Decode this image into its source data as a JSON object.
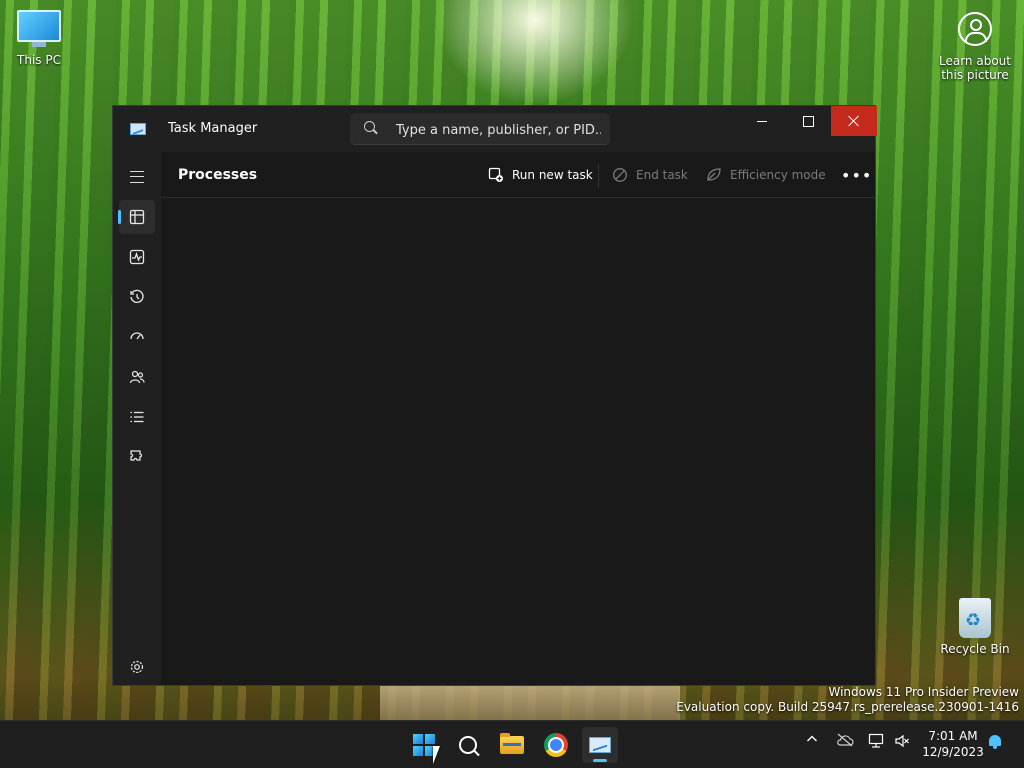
{
  "desktop": {
    "this_pc_label": "This PC",
    "learn_label": "Learn about this picture",
    "recycle_label": "Recycle Bin",
    "watermark_line1": "Windows 11 Pro Insider Preview",
    "watermark_line2": "Evaluation copy. Build 25947.rs_prerelease.230901-1416"
  },
  "window": {
    "title": "Task Manager",
    "search_placeholder": "Type a name, publisher, or PID...",
    "page_title": "Processes",
    "toolbar": {
      "run_new_task": "Run new task",
      "end_task": "End task",
      "efficiency_mode": "Efficiency mode"
    },
    "nav_items": [
      {
        "name": "menu",
        "icon": "hamburger-icon"
      },
      {
        "name": "processes",
        "icon": "processes-icon",
        "active": true
      },
      {
        "name": "performance",
        "icon": "performance-icon"
      },
      {
        "name": "app-history",
        "icon": "history-icon"
      },
      {
        "name": "startup-apps",
        "icon": "startup-icon"
      },
      {
        "name": "users",
        "icon": "users-icon"
      },
      {
        "name": "details",
        "icon": "details-list-icon"
      },
      {
        "name": "services",
        "icon": "services-icon"
      },
      {
        "name": "settings",
        "icon": "gear-icon"
      }
    ]
  },
  "taskbar": {
    "time": "7:01 AM",
    "date": "12/9/2023",
    "items": [
      "start-icon",
      "search-icon",
      "file-explorer-icon",
      "chrome-icon",
      "task-manager-icon"
    ]
  },
  "colors": {
    "accent": "#4cc2ff",
    "close_red": "#c42b1c",
    "window_bg": "#1c1c1c"
  }
}
